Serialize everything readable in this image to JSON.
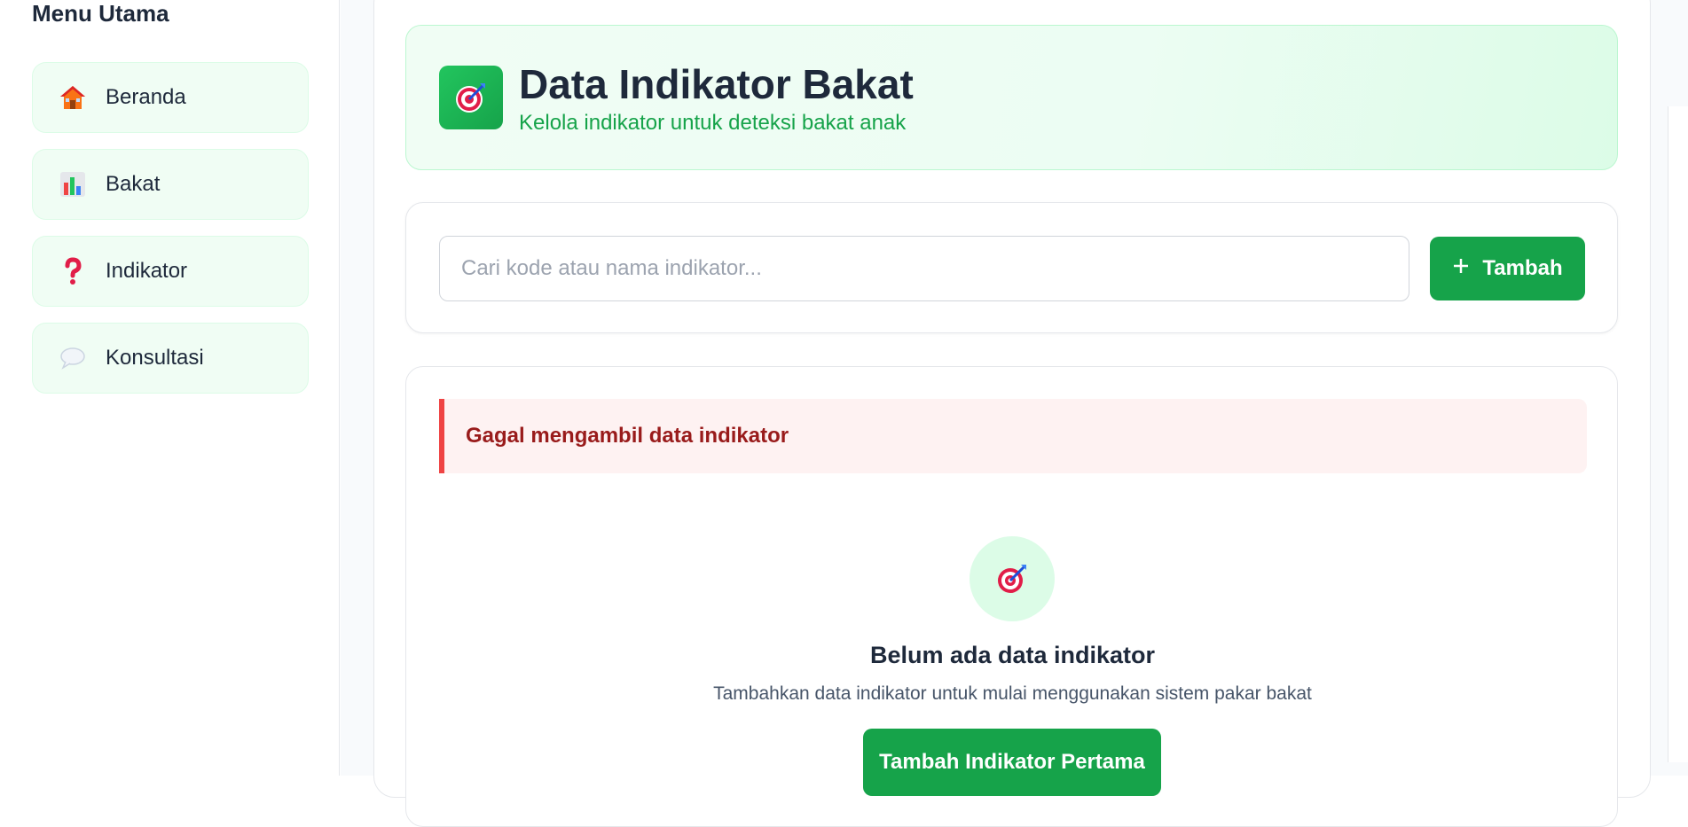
{
  "sidebar": {
    "title": "Menu Utama",
    "items": [
      {
        "label": "Beranda",
        "icon": "house-icon"
      },
      {
        "label": "Bakat",
        "icon": "bar-chart-icon"
      },
      {
        "label": "Indikator",
        "icon": "question-mark-icon"
      },
      {
        "label": "Konsultasi",
        "icon": "speech-bubble-icon"
      }
    ]
  },
  "header": {
    "icon": "target-icon",
    "title": "Data Indikator Bakat",
    "subtitle": "Kelola indikator untuk deteksi bakat anak"
  },
  "search": {
    "placeholder": "Cari kode atau nama indikator...",
    "value": "",
    "add_label": "Tambah",
    "add_icon": "plus-icon"
  },
  "error": {
    "message": "Gagal mengambil data indikator"
  },
  "empty_state": {
    "icon": "target-icon",
    "title": "Belum ada data indikator",
    "description": "Tambahkan data indikator untuk mulai menggunakan sistem pakar bakat",
    "button_label": "Tambah Indikator Pertama"
  },
  "colors": {
    "primary": "#16a34a",
    "error": "#ef4444",
    "error_text": "#991b1b",
    "nav_bg": "#f0fdf4"
  }
}
